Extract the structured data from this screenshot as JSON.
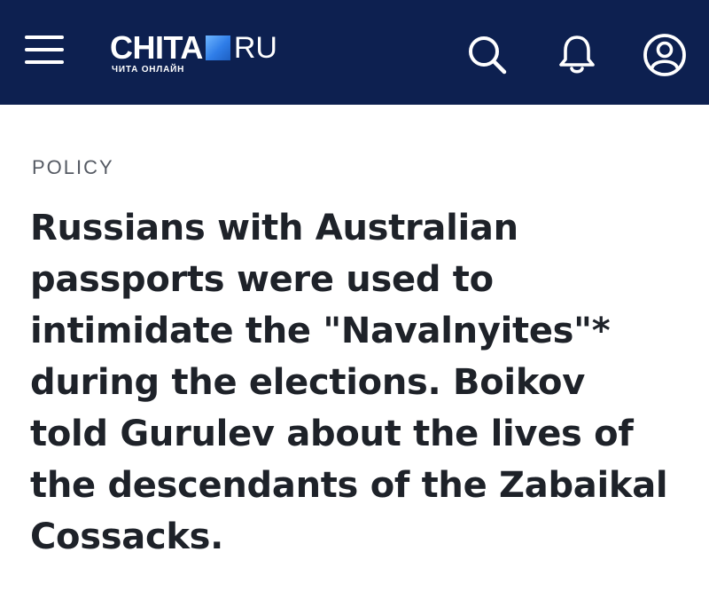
{
  "header": {
    "logo": {
      "brand": "CHITA",
      "tld": "RU",
      "tagline": "ЧИТА ОНЛАЙН"
    },
    "icons": {
      "menu": "hamburger-menu-icon",
      "search": "search-icon",
      "notifications": "bell-icon",
      "account": "user-icon"
    },
    "colors": {
      "background": "#0d2050",
      "logo_square": "#2f7de8"
    }
  },
  "article": {
    "category": "POLICY",
    "title": "Russians with Australian passports were used to intimidate the \"Navalnyites\"* during the elections. Boikov told Gurulev about the lives of the descendants of the Zabaikal Cossacks."
  }
}
